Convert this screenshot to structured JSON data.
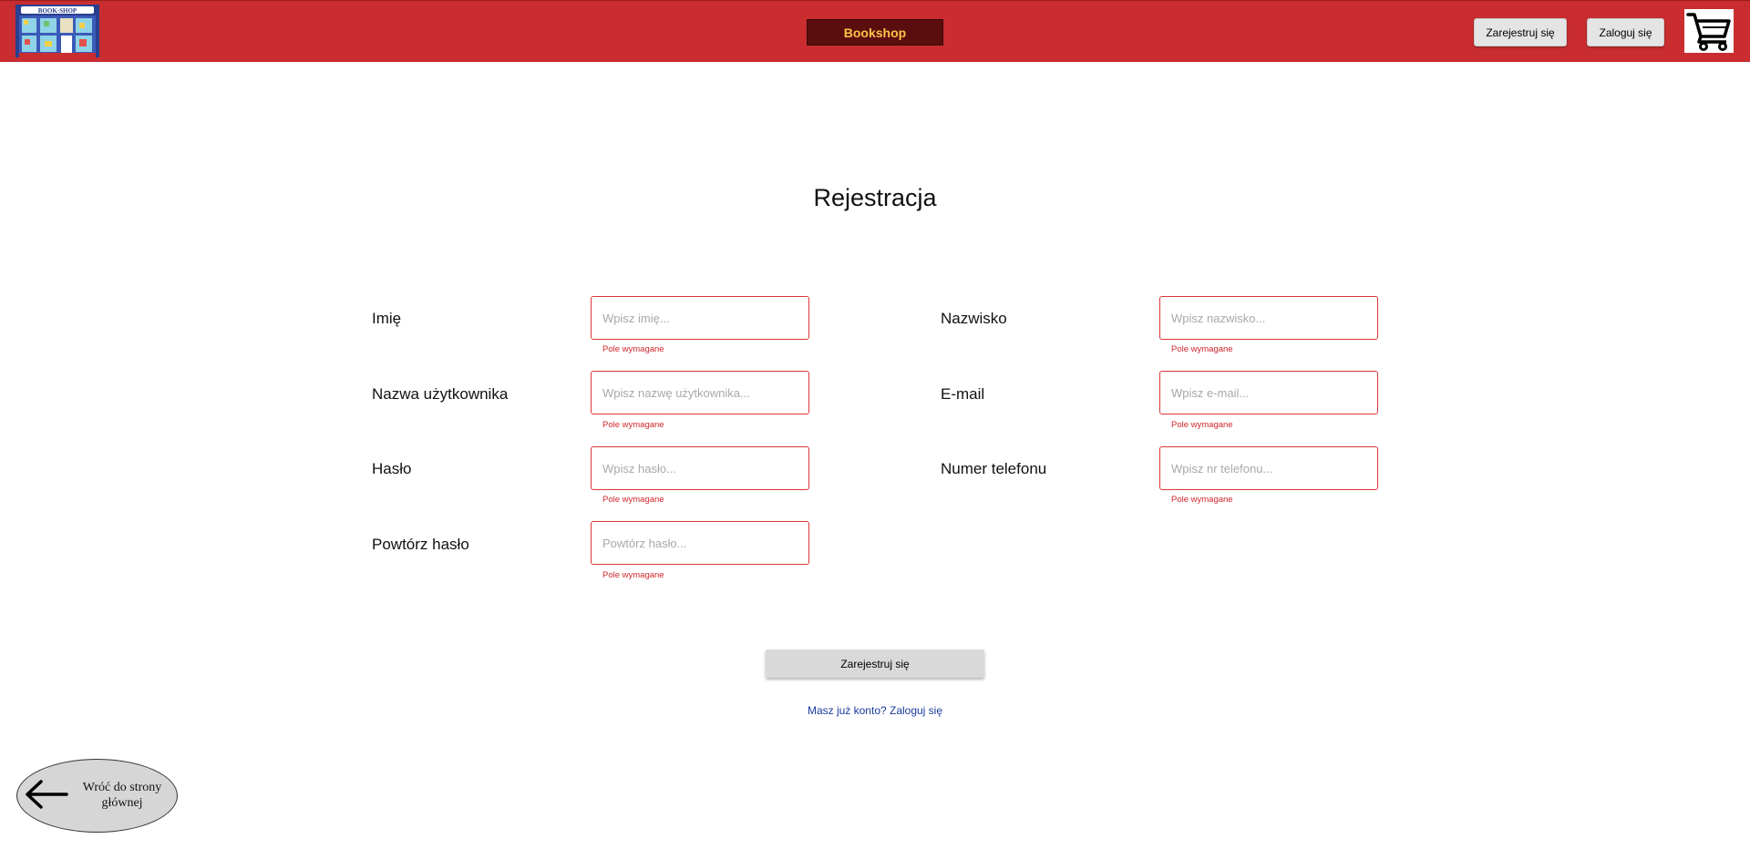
{
  "header": {
    "logo_text": "BOOK·SHOP",
    "brand": "Bookshop",
    "register_label": "Zarejestruj się",
    "login_label": "Zaloguj się",
    "cart_icon": "shopping-cart-icon",
    "background_color": "#c92d2f"
  },
  "form": {
    "title": "Rejestracja",
    "fields": [
      {
        "label": "Imię",
        "placeholder": "Wpisz imię...",
        "error": "Pole wymagane"
      },
      {
        "label": "Nazwisko",
        "placeholder": "Wpisz nazwisko...",
        "error": "Pole wymagane"
      },
      {
        "label": "Nazwa użytkownika",
        "placeholder": "Wpisz nazwę użytkownika...",
        "error": "Pole wymagane"
      },
      {
        "label": "E-mail",
        "placeholder": "Wpisz e-mail...",
        "error": "Pole wymagane"
      },
      {
        "label": "Hasło",
        "placeholder": "Wpisz hasło...",
        "error": "Pole wymagane"
      },
      {
        "label": "Numer telefonu",
        "placeholder": "Wpisz nr telefonu...",
        "error": "Pole wymagane"
      },
      {
        "label": "Powtórz hasło",
        "placeholder": "Powtórz hasło...",
        "error": "Pole wymagane"
      }
    ],
    "submit_label": "Zarejestruj się",
    "login_link": "Masz już konto? Zaloguj się",
    "error_color": "#d0262a"
  },
  "back": {
    "label": "Wróć do strony głównej",
    "icon": "arrow-left-icon"
  }
}
